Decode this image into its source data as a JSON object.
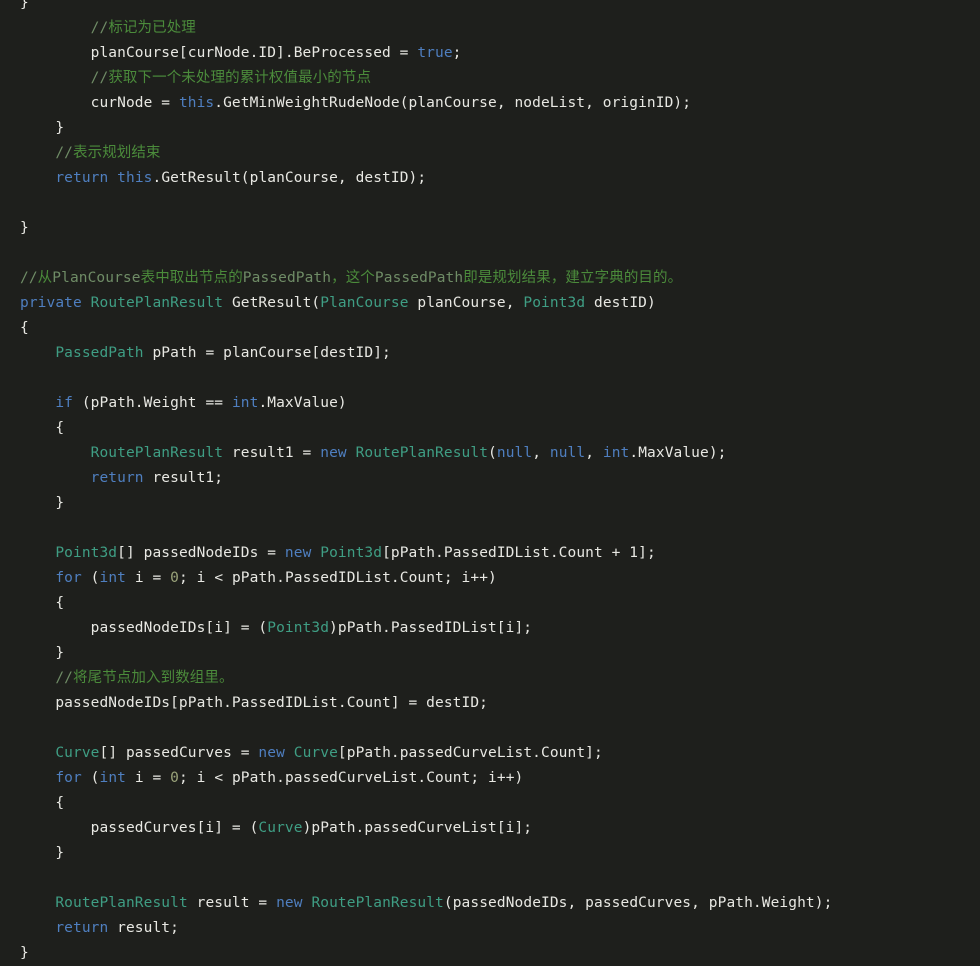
{
  "editor": {
    "language": "C#",
    "background_color": "#1e1f1c",
    "foreground_color": "#e8e8e3",
    "palette": {
      "keyword": "#4f7fc0",
      "type": "#3f9e84",
      "comment": "#4b8b3b",
      "comment_ascii": "#6f8c66",
      "number": "#9aa37a",
      "plain": "#e8e8e3"
    },
    "lines": [
      {
        "indent": 0,
        "tokens": [
          {
            "t": "}",
            "c": "txt"
          }
        ]
      },
      {
        "indent": 0,
        "tokens": [
          {
            "t": "        ",
            "c": "txt"
          },
          {
            "t": "//",
            "c": "cmt-ascii"
          },
          {
            "t": "标记为已处理",
            "c": "cmt"
          }
        ]
      },
      {
        "indent": 0,
        "tokens": [
          {
            "t": "        planCourse[curNode.ID].BeProcessed = ",
            "c": "txt"
          },
          {
            "t": "true",
            "c": "kw"
          },
          {
            "t": ";",
            "c": "txt"
          }
        ]
      },
      {
        "indent": 0,
        "tokens": [
          {
            "t": "        ",
            "c": "txt"
          },
          {
            "t": "//",
            "c": "cmt-ascii"
          },
          {
            "t": "获取下一个未处理的累计权值最小的节点",
            "c": "cmt"
          }
        ]
      },
      {
        "indent": 0,
        "tokens": [
          {
            "t": "        curNode = ",
            "c": "txt"
          },
          {
            "t": "this",
            "c": "kw"
          },
          {
            "t": ".GetMinWeightRudeNode(planCourse, nodeList, originID);",
            "c": "txt"
          }
        ]
      },
      {
        "indent": 0,
        "tokens": [
          {
            "t": "    }",
            "c": "txt"
          }
        ]
      },
      {
        "indent": 0,
        "tokens": [
          {
            "t": "    ",
            "c": "txt"
          },
          {
            "t": "//",
            "c": "cmt-ascii"
          },
          {
            "t": "表示规划结束",
            "c": "cmt"
          }
        ]
      },
      {
        "indent": 0,
        "tokens": [
          {
            "t": "    ",
            "c": "txt"
          },
          {
            "t": "return",
            "c": "kw"
          },
          {
            "t": " ",
            "c": "txt"
          },
          {
            "t": "this",
            "c": "kw"
          },
          {
            "t": ".GetResult(planCourse, destID);",
            "c": "txt"
          }
        ]
      },
      {
        "indent": 0,
        "tokens": []
      },
      {
        "indent": 0,
        "tokens": [
          {
            "t": "}",
            "c": "txt"
          }
        ]
      },
      {
        "indent": 0,
        "tokens": []
      },
      {
        "indent": 0,
        "tokens": [
          {
            "t": "//",
            "c": "cmt-ascii"
          },
          {
            "t": "从",
            "c": "cmt"
          },
          {
            "t": "PlanCourse",
            "c": "cmt-ascii"
          },
          {
            "t": "表中取出节点的",
            "c": "cmt"
          },
          {
            "t": "PassedPath",
            "c": "cmt-ascii"
          },
          {
            "t": "，这个",
            "c": "cmt"
          },
          {
            "t": "PassedPath",
            "c": "cmt-ascii"
          },
          {
            "t": "即是规划结果，建立字典的目的。",
            "c": "cmt"
          }
        ]
      },
      {
        "indent": 0,
        "tokens": [
          {
            "t": "private",
            "c": "kw"
          },
          {
            "t": " ",
            "c": "txt"
          },
          {
            "t": "RoutePlanResult",
            "c": "type"
          },
          {
            "t": " GetResult(",
            "c": "txt"
          },
          {
            "t": "PlanCourse",
            "c": "type"
          },
          {
            "t": " planCourse, ",
            "c": "txt"
          },
          {
            "t": "Point3d",
            "c": "type"
          },
          {
            "t": " destID)",
            "c": "txt"
          }
        ]
      },
      {
        "indent": 0,
        "tokens": [
          {
            "t": "{",
            "c": "txt"
          }
        ]
      },
      {
        "indent": 0,
        "tokens": [
          {
            "t": "    ",
            "c": "txt"
          },
          {
            "t": "PassedPath",
            "c": "type"
          },
          {
            "t": " pPath = planCourse[destID];",
            "c": "txt"
          }
        ]
      },
      {
        "indent": 0,
        "tokens": []
      },
      {
        "indent": 0,
        "tokens": [
          {
            "t": "    ",
            "c": "txt"
          },
          {
            "t": "if",
            "c": "kw"
          },
          {
            "t": " (pPath.Weight == ",
            "c": "txt"
          },
          {
            "t": "int",
            "c": "kw"
          },
          {
            "t": ".MaxValue)",
            "c": "txt"
          }
        ]
      },
      {
        "indent": 0,
        "tokens": [
          {
            "t": "    {",
            "c": "txt"
          }
        ]
      },
      {
        "indent": 0,
        "tokens": [
          {
            "t": "        ",
            "c": "txt"
          },
          {
            "t": "RoutePlanResult",
            "c": "type"
          },
          {
            "t": " result1 = ",
            "c": "txt"
          },
          {
            "t": "new",
            "c": "kw"
          },
          {
            "t": " ",
            "c": "txt"
          },
          {
            "t": "RoutePlanResult",
            "c": "type"
          },
          {
            "t": "(",
            "c": "txt"
          },
          {
            "t": "null",
            "c": "kw"
          },
          {
            "t": ", ",
            "c": "txt"
          },
          {
            "t": "null",
            "c": "kw"
          },
          {
            "t": ", ",
            "c": "txt"
          },
          {
            "t": "int",
            "c": "kw"
          },
          {
            "t": ".MaxValue);",
            "c": "txt"
          }
        ]
      },
      {
        "indent": 0,
        "tokens": [
          {
            "t": "        ",
            "c": "txt"
          },
          {
            "t": "return",
            "c": "kw"
          },
          {
            "t": " result1;",
            "c": "txt"
          }
        ]
      },
      {
        "indent": 0,
        "tokens": [
          {
            "t": "    }",
            "c": "txt"
          }
        ]
      },
      {
        "indent": 0,
        "tokens": []
      },
      {
        "indent": 0,
        "tokens": [
          {
            "t": "    ",
            "c": "txt"
          },
          {
            "t": "Point3d",
            "c": "type"
          },
          {
            "t": "[] passedNodeIDs = ",
            "c": "txt"
          },
          {
            "t": "new",
            "c": "kw"
          },
          {
            "t": " ",
            "c": "txt"
          },
          {
            "t": "Point3d",
            "c": "type"
          },
          {
            "t": "[pPath.PassedIDList.Count + 1];",
            "c": "txt"
          }
        ]
      },
      {
        "indent": 0,
        "tokens": [
          {
            "t": "    ",
            "c": "txt"
          },
          {
            "t": "for",
            "c": "kw"
          },
          {
            "t": " (",
            "c": "txt"
          },
          {
            "t": "int",
            "c": "kw"
          },
          {
            "t": " i = ",
            "c": "txt"
          },
          {
            "t": "0",
            "c": "num"
          },
          {
            "t": "; i < pPath.PassedIDList.Count; i++)",
            "c": "txt"
          }
        ]
      },
      {
        "indent": 0,
        "tokens": [
          {
            "t": "    {",
            "c": "txt"
          }
        ]
      },
      {
        "indent": 0,
        "tokens": [
          {
            "t": "        passedNodeIDs[i] = (",
            "c": "txt"
          },
          {
            "t": "Point3d",
            "c": "type"
          },
          {
            "t": ")pPath.PassedIDList[i];",
            "c": "txt"
          }
        ]
      },
      {
        "indent": 0,
        "tokens": [
          {
            "t": "    }",
            "c": "txt"
          }
        ]
      },
      {
        "indent": 0,
        "tokens": [
          {
            "t": "    ",
            "c": "txt"
          },
          {
            "t": "//",
            "c": "cmt-ascii"
          },
          {
            "t": "将尾节点加入到数组里。",
            "c": "cmt"
          }
        ]
      },
      {
        "indent": 0,
        "tokens": [
          {
            "t": "    passedNodeIDs[pPath.PassedIDList.Count] = destID;",
            "c": "txt"
          }
        ]
      },
      {
        "indent": 0,
        "tokens": []
      },
      {
        "indent": 0,
        "tokens": [
          {
            "t": "    ",
            "c": "txt"
          },
          {
            "t": "Curve",
            "c": "type"
          },
          {
            "t": "[] passedCurves = ",
            "c": "txt"
          },
          {
            "t": "new",
            "c": "kw"
          },
          {
            "t": " ",
            "c": "txt"
          },
          {
            "t": "Curve",
            "c": "type"
          },
          {
            "t": "[pPath.passedCurveList.Count];",
            "c": "txt"
          }
        ]
      },
      {
        "indent": 0,
        "tokens": [
          {
            "t": "    ",
            "c": "txt"
          },
          {
            "t": "for",
            "c": "kw"
          },
          {
            "t": " (",
            "c": "txt"
          },
          {
            "t": "int",
            "c": "kw"
          },
          {
            "t": " i = ",
            "c": "txt"
          },
          {
            "t": "0",
            "c": "num"
          },
          {
            "t": "; i < pPath.passedCurveList.Count; i++)",
            "c": "txt"
          }
        ]
      },
      {
        "indent": 0,
        "tokens": [
          {
            "t": "    {",
            "c": "txt"
          }
        ]
      },
      {
        "indent": 0,
        "tokens": [
          {
            "t": "        passedCurves[i] = (",
            "c": "txt"
          },
          {
            "t": "Curve",
            "c": "type"
          },
          {
            "t": ")pPath.passedCurveList[i];",
            "c": "txt"
          }
        ]
      },
      {
        "indent": 0,
        "tokens": [
          {
            "t": "    }",
            "c": "txt"
          }
        ]
      },
      {
        "indent": 0,
        "tokens": []
      },
      {
        "indent": 0,
        "tokens": [
          {
            "t": "    ",
            "c": "txt"
          },
          {
            "t": "RoutePlanResult",
            "c": "type"
          },
          {
            "t": " result = ",
            "c": "txt"
          },
          {
            "t": "new",
            "c": "kw"
          },
          {
            "t": " ",
            "c": "txt"
          },
          {
            "t": "RoutePlanResult",
            "c": "type"
          },
          {
            "t": "(passedNodeIDs, passedCurves, pPath.Weight);",
            "c": "txt"
          }
        ]
      },
      {
        "indent": 0,
        "tokens": [
          {
            "t": "    ",
            "c": "txt"
          },
          {
            "t": "return",
            "c": "kw"
          },
          {
            "t": " result;",
            "c": "txt"
          }
        ]
      },
      {
        "indent": 0,
        "tokens": [
          {
            "t": "}",
            "c": "txt"
          }
        ]
      }
    ]
  }
}
